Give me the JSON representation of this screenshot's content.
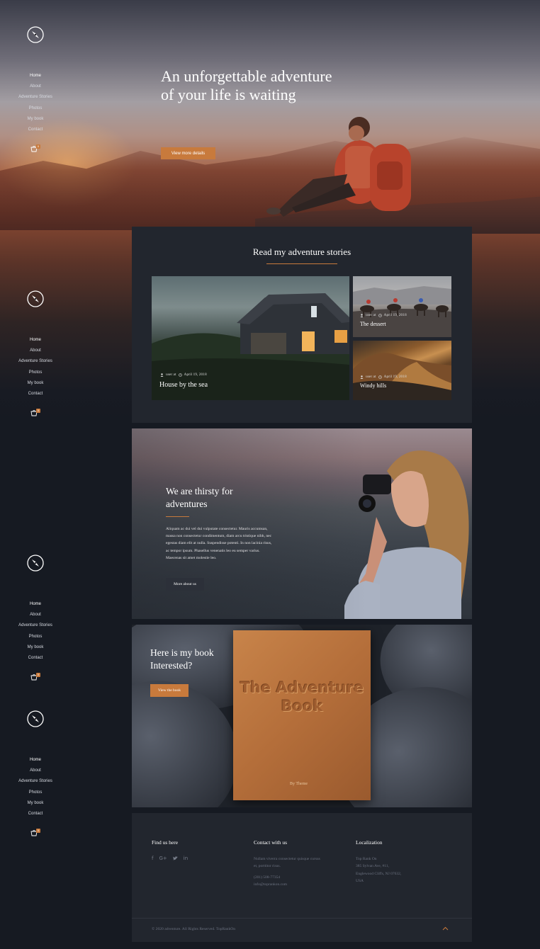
{
  "nav": {
    "items": [
      "Home",
      "About",
      "Adventure Stories",
      "Photos",
      "My book",
      "Contact"
    ],
    "cart_count": "0"
  },
  "hero": {
    "title": "An unforgettable adventure of your life is waiting",
    "button": "View more details"
  },
  "stories": {
    "heading": "Read my adventure stories",
    "cards": [
      {
        "user": "user at",
        "date": "April 19, 2018",
        "title": "House by the sea"
      },
      {
        "user": "user at",
        "date": "April 19, 2018",
        "title": "The dessert"
      },
      {
        "user": "user at",
        "date": "April 19, 2018",
        "title": "Windy hills"
      }
    ]
  },
  "about": {
    "heading": "We are thirsty for adventures",
    "body": "Aliquam ac dui vel dui vulputate consectetur. Mauris accumsan, massa non consectetur condimentum, diam arcu tristique nibh, nec egestas diam elit at nulla. Suspendisse potenti. In non lacinia risus, ac tempor ipsum. Phasellus venenatis leo eu semper varius. Maecenas sit amet molestie leo.",
    "button": "More about us"
  },
  "book": {
    "heading": "Here is my book Interested?",
    "button": "View the book",
    "cover_title": "The Adventure Book",
    "cover_author": "By Theme"
  },
  "footer": {
    "find_heading": "Find us here",
    "social": [
      "f",
      "G+",
      "t",
      "in"
    ],
    "contact_heading": "Contact with us",
    "contact_text": "Nullam viverra consectetur quisque cursus et, porttitor risus.",
    "phone": "(201) 508-77354",
    "email": "info@toprankon.com",
    "local_heading": "Localization",
    "company": "Top Rank On",
    "street": "385 Sylvan Ave, #11,",
    "city": "Englewood Cliffs, NJ 07632,",
    "country": "USA",
    "copyright": "© 2020 adventure. All Rights Reserved. TopRankOn"
  },
  "colors": {
    "accent": "#c87a3c",
    "panel": "#22262e",
    "background": "#161a22"
  }
}
